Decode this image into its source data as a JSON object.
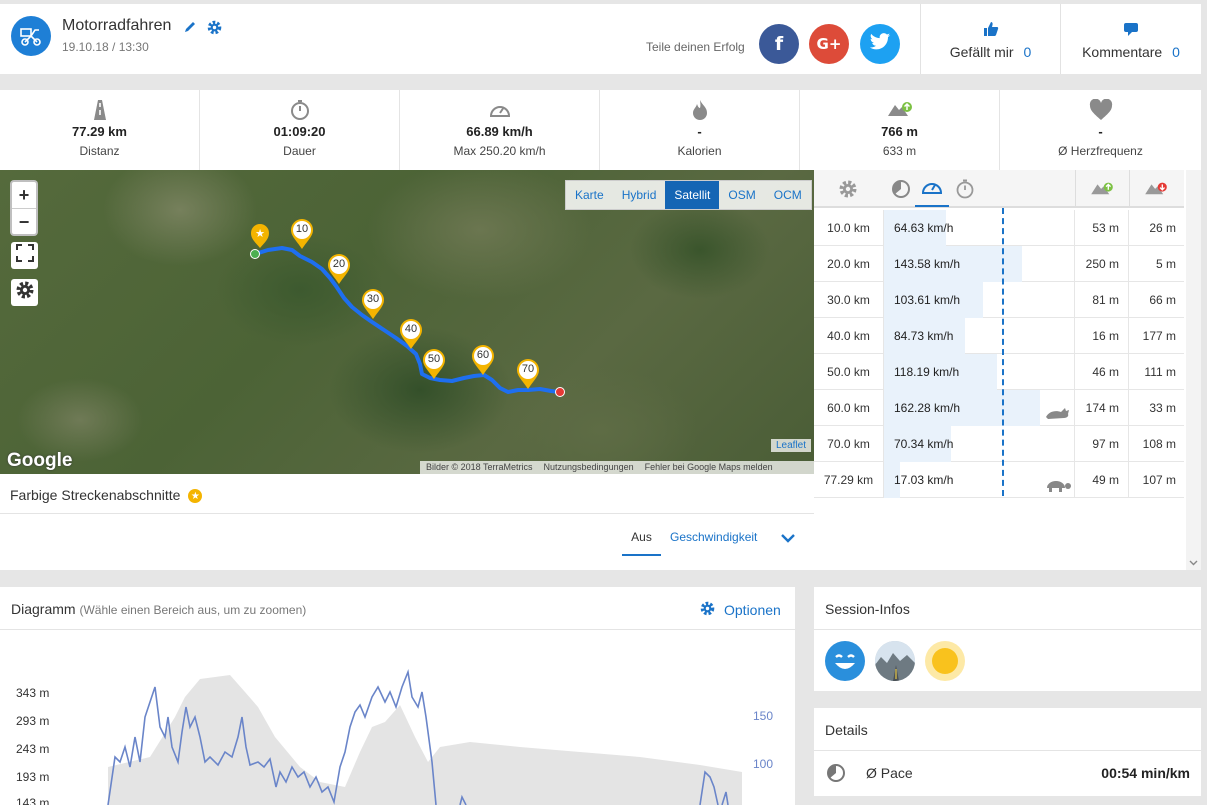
{
  "activity": {
    "title": "Motorradfahren",
    "date": "19.10.18 / 13:30",
    "icon": "motorbike-icon",
    "brand_color": "#1e7fd6"
  },
  "share": {
    "label": "Teile deinen Erfolg",
    "facebook": "f",
    "google": "G+",
    "twitter": "t",
    "colors": {
      "facebook": "#3b5998",
      "google": "#dd4b39",
      "twitter": "#1da1f2"
    }
  },
  "social": {
    "likes_label": "Gefällt mir",
    "likes_count": "0",
    "comments_label": "Kommentare",
    "comments_count": "0"
  },
  "stats": [
    {
      "icon": "road-icon",
      "value": "77.29 km",
      "label": "Distanz"
    },
    {
      "icon": "stopwatch-icon",
      "value": "01:09:20",
      "label": "Dauer"
    },
    {
      "icon": "speedometer-icon",
      "value": "66.89 km/h",
      "label": "Max 250.20 km/h"
    },
    {
      "icon": "flame-icon",
      "value": "-",
      "label": "Kalorien"
    },
    {
      "icon": "elevation-up-icon",
      "value": "766 m",
      "label": "633 m"
    },
    {
      "icon": "heart-icon",
      "value": "-",
      "label": "Ø Herzfrequenz"
    }
  ],
  "map": {
    "zoom_in": "+",
    "zoom_out": "−",
    "layers": [
      "Karte",
      "Hybrid",
      "Satellit",
      "OSM",
      "OCM"
    ],
    "active_layer": "Satellit",
    "markers": [
      "10",
      "20",
      "30",
      "40",
      "50",
      "60",
      "70"
    ],
    "google": "Google",
    "attribution": [
      "Bilder © 2018 TerraMetrics",
      "Nutzungsbedingungen",
      "Fehler bei Google Maps melden"
    ],
    "leaflet": "Leaflet",
    "route_color": "#1e6ff0"
  },
  "segments": {
    "rows": [
      {
        "dist": "10.0 km",
        "speed": "64.63 km/h",
        "up": "53 m",
        "down": "26 m",
        "badge": ""
      },
      {
        "dist": "20.0 km",
        "speed": "143.58 km/h",
        "up": "250 m",
        "down": "5 m",
        "badge": ""
      },
      {
        "dist": "30.0 km",
        "speed": "103.61 km/h",
        "up": "81 m",
        "down": "66 m",
        "badge": ""
      },
      {
        "dist": "40.0 km",
        "speed": "84.73 km/h",
        "up": "16 m",
        "down": "177 m",
        "badge": ""
      },
      {
        "dist": "50.0 km",
        "speed": "118.19 km/h",
        "up": "46 m",
        "down": "111 m",
        "badge": ""
      },
      {
        "dist": "60.0 km",
        "speed": "162.28 km/h",
        "up": "174 m",
        "down": "33 m",
        "badge": "rabbit-icon"
      },
      {
        "dist": "70.0 km",
        "speed": "70.34 km/h",
        "up": "97 m",
        "down": "108 m",
        "badge": ""
      },
      {
        "dist": "77.29 km",
        "speed": "17.03 km/h",
        "up": "49 m",
        "down": "107 m",
        "badge": "turtle-icon"
      }
    ],
    "speed_values": [
      64.63,
      143.58,
      103.61,
      84.73,
      118.19,
      162.28,
      70.34,
      17.03
    ]
  },
  "colored_sections": {
    "label": "Farbige Streckenabschnitte",
    "tab_off": "Aus",
    "tab_speed": "Geschwindigkeit"
  },
  "diagram": {
    "title": "Diagramm",
    "hint": "(Wähle einen Bereich aus, um zu zoomen)",
    "options": "Optionen",
    "y_left": [
      "343 m",
      "293 m",
      "243 m",
      "193 m",
      "143 m"
    ],
    "y_right": [
      "150",
      "100"
    ]
  },
  "session": {
    "title": "Session-Infos",
    "icons": [
      "smiley-icon",
      "road-surface-icon",
      "sun-icon"
    ]
  },
  "details": {
    "title": "Details",
    "pace_label": "Ø Pace",
    "pace_value": "00:54 min/km"
  }
}
